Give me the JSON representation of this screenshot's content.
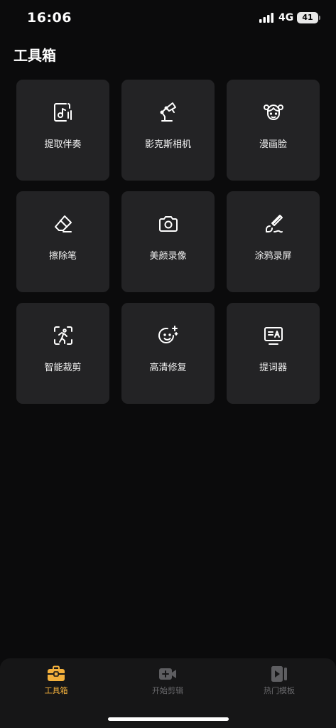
{
  "status": {
    "time": "16:06",
    "network": "4G",
    "battery": "41"
  },
  "page": {
    "title": "工具箱"
  },
  "tools": [
    {
      "label": "提取伴奏",
      "icon": "music-extract-icon"
    },
    {
      "label": "影克斯相机",
      "icon": "desk-lamp-icon"
    },
    {
      "label": "漫画脸",
      "icon": "cartoon-face-icon"
    },
    {
      "label": "擦除笔",
      "icon": "eraser-icon"
    },
    {
      "label": "美颜录像",
      "icon": "camera-icon"
    },
    {
      "label": "涂鸦录屏",
      "icon": "brush-icon"
    },
    {
      "label": "智能裁剪",
      "icon": "smart-crop-icon"
    },
    {
      "label": "高清修复",
      "icon": "sparkle-face-icon"
    },
    {
      "label": "提词器",
      "icon": "teleprompter-icon"
    }
  ],
  "tabs": [
    {
      "label": "工具箱",
      "icon": "toolbox-icon",
      "active": true
    },
    {
      "label": "开始剪辑",
      "icon": "video-add-icon",
      "active": false
    },
    {
      "label": "热门模板",
      "icon": "template-play-icon",
      "active": false
    }
  ],
  "colors": {
    "accent": "#f3b03c",
    "card": "#232325",
    "background": "#0b0b0c"
  }
}
